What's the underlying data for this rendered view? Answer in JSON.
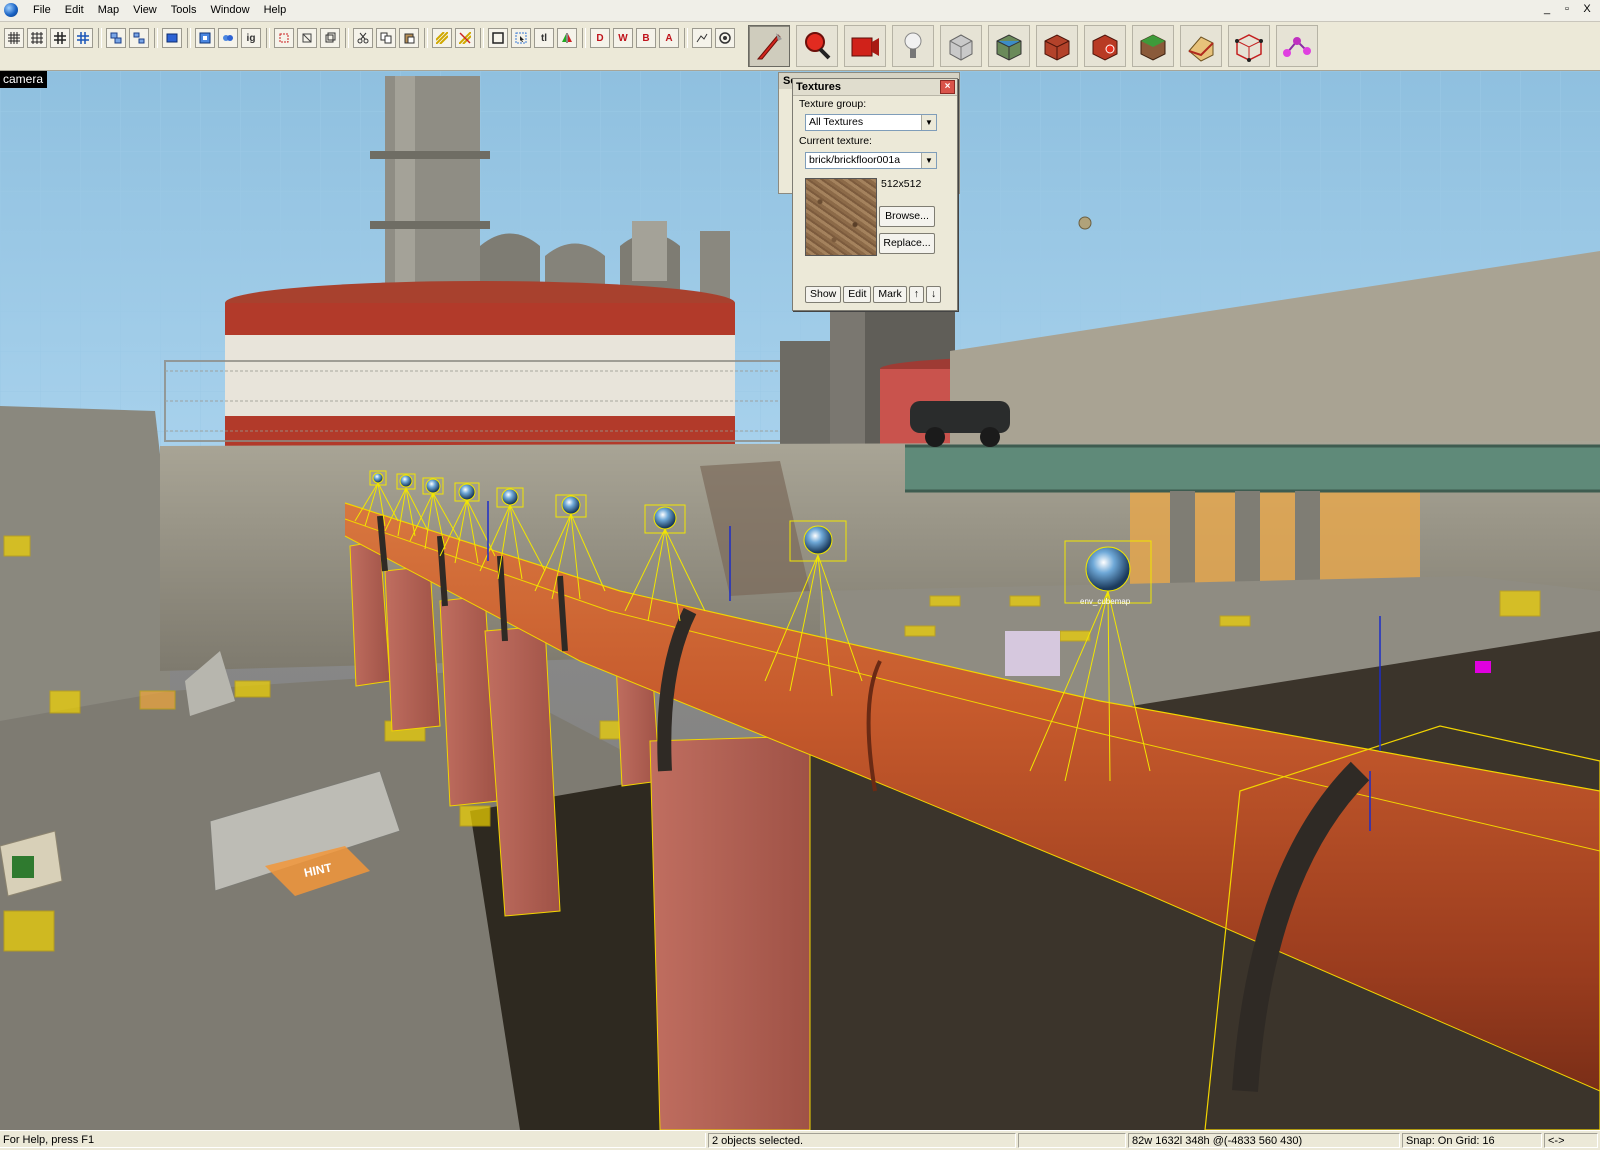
{
  "menu": {
    "items": [
      "File",
      "Edit",
      "Map",
      "View",
      "Tools",
      "Window",
      "Help"
    ]
  },
  "window_controls": {
    "minimize": "_",
    "restore": "▫",
    "close": "X"
  },
  "toolbar": {
    "small_buttons": [
      "grid-toggle",
      "3d-grid",
      "grid-dense",
      "grid-add",
      "group-1",
      "group-2",
      "carve",
      "select-1",
      "select-2",
      "ig-label",
      "hide",
      "hide-2",
      "show-all",
      "cut",
      "copy",
      "paste",
      "texture-lock",
      "texture-scale",
      "bounds",
      "select-all",
      "tl-label",
      "flip",
      "align-1",
      "align-2",
      "align-3",
      "align-4",
      "vis-1",
      "vis-2"
    ],
    "small_button_text": {
      "ig": "ig",
      "tl": "tl",
      "D1": "D",
      "D2": "W",
      "D3": "B",
      "D4": "A"
    },
    "tools": [
      {
        "name": "selection-tool",
        "active": true
      },
      {
        "name": "magnify-tool",
        "active": false
      },
      {
        "name": "camera-tool",
        "active": false
      },
      {
        "name": "entity-tool",
        "active": false
      },
      {
        "name": "block-tool",
        "active": false
      },
      {
        "name": "texture-application-tool",
        "active": false
      },
      {
        "name": "apply-texture-tool",
        "active": false
      },
      {
        "name": "decal-tool",
        "active": false
      },
      {
        "name": "overlay-tool",
        "active": false
      },
      {
        "name": "clip-tool",
        "active": false
      },
      {
        "name": "vertex-tool",
        "active": false
      },
      {
        "name": "path-tool",
        "active": false
      }
    ]
  },
  "viewport": {
    "label": "camera",
    "entity_label": "env_cubemap",
    "hint_label": "HINT"
  },
  "textures_panel": {
    "back_title": "Se",
    "title": "Textures",
    "close": "×",
    "group_label": "Texture group:",
    "group_value": "All Textures",
    "current_label": "Current texture:",
    "current_value": "brick/brickfloor001a",
    "size": "512x512",
    "browse": "Browse...",
    "replace": "Replace...",
    "show": "Show",
    "edit": "Edit",
    "mark": "Mark",
    "up": "↑",
    "down": "↓"
  },
  "status": {
    "help": "For Help, press F1",
    "selection": "2 objects selected.",
    "blank": "",
    "dimensions": "82w 1632l 348h @(-4833 560 430)",
    "snap": "Snap: On Grid: 16",
    "extra": "<->"
  }
}
